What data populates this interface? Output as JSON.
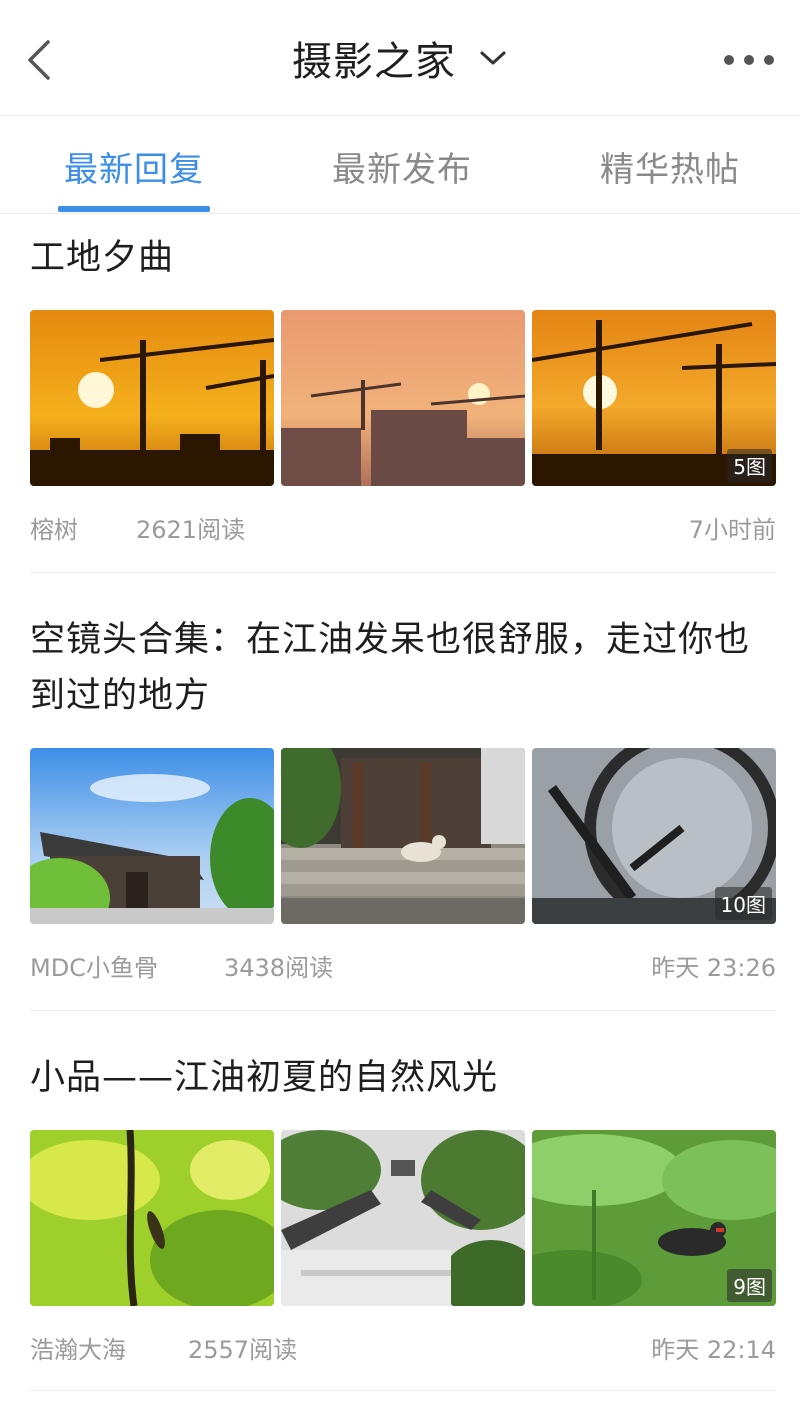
{
  "header": {
    "title": "摄影之家",
    "back_icon": "chevron-left-icon",
    "dropdown_icon": "chevron-down-icon",
    "more_icon": "more-dots-icon"
  },
  "tabs": [
    {
      "label": "最新回复",
      "active": true
    },
    {
      "label": "最新发布",
      "active": false
    },
    {
      "label": "精华热帖",
      "active": false
    }
  ],
  "colors": {
    "accent": "#3c8ee6",
    "meta_text": "#9b9b9b"
  },
  "posts": [
    {
      "title": "工地夕曲",
      "image_count": "5图",
      "author": "榕树",
      "reads": "2621阅读",
      "time": "7小时前"
    },
    {
      "title": "空镜头合集：在江油发呆也很舒服，走过你也到过的地方",
      "image_count": "10图",
      "author": "MDC小鱼骨",
      "reads": "3438阅读",
      "time": "昨天  23:26"
    },
    {
      "title": "小品——江油初夏的自然风光",
      "image_count": "9图",
      "author": "浩瀚大海",
      "reads": "2557阅读",
      "time": "昨天  22:14"
    }
  ]
}
